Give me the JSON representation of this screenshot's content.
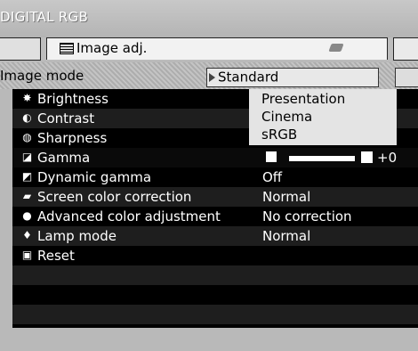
{
  "window": {
    "title": "DIGITAL RGB"
  },
  "tabs": {
    "active_label": "Image adj."
  },
  "image_mode": {
    "label": "Image mode",
    "value": "Standard"
  },
  "dropdown_options": [
    "Presentation",
    "Cinema",
    "sRGB"
  ],
  "menu": [
    {
      "icon": "brightness-icon",
      "label": "Brightness",
      "value": ""
    },
    {
      "icon": "contrast-icon",
      "label": "Contrast",
      "value": ""
    },
    {
      "icon": "sharpness-icon",
      "label": "Sharpness",
      "value": ""
    },
    {
      "icon": "gamma-icon",
      "label": "Gamma",
      "value": "+0"
    },
    {
      "icon": "dynamic-gamma-icon",
      "label": "Dynamic gamma",
      "value": "Off"
    },
    {
      "icon": "screen-color-icon",
      "label": "Screen color correction",
      "value": "Normal"
    },
    {
      "icon": "advanced-color-icon",
      "label": "Advanced color adjustment",
      "value": "No correction"
    },
    {
      "icon": "lamp-icon",
      "label": "Lamp mode",
      "value": "Normal"
    },
    {
      "icon": "reset-icon",
      "label": "Reset",
      "value": ""
    }
  ],
  "gamma": {
    "value": "+0",
    "level": 0.5
  }
}
